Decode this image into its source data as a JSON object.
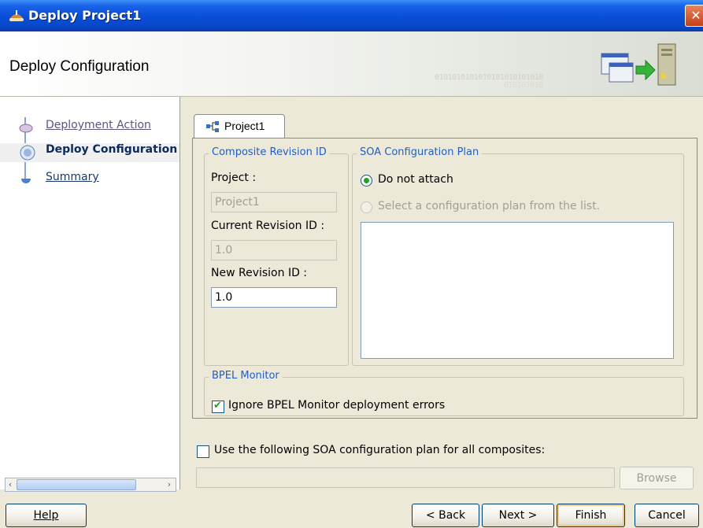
{
  "window": {
    "title": "Deploy Project1",
    "close_glyph": "✕"
  },
  "banner": {
    "heading": "Deploy Configuration",
    "binary_line1": "0101010101010101010101010",
    "binary_line2": "010101010"
  },
  "nav": {
    "items": [
      {
        "label": "Deployment Action",
        "state": "visited"
      },
      {
        "label": "Deploy Configuration",
        "state": "current"
      },
      {
        "label": "Summary",
        "state": "link"
      }
    ]
  },
  "tab": {
    "label": "Project1"
  },
  "revision": {
    "legend": "Composite Revision ID",
    "project_label": "Project :",
    "project_value": "Project1",
    "current_label": "Current Revision ID :",
    "current_value": "1.0",
    "new_label": "New Revision ID :",
    "new_value": "1.0"
  },
  "plan": {
    "legend": "SOA Configuration Plan",
    "option_none": "Do not attach",
    "option_select": "Select a configuration plan from the list."
  },
  "monitor": {
    "legend": "BPEL Monitor",
    "ignore_errors_label": "Ignore BPEL Monitor deployment errors",
    "ignore_errors_checked": true
  },
  "all_composites": {
    "label": "Use the following SOA configuration plan for all composites:",
    "checked": false,
    "path_value": "",
    "browse_label": "Browse"
  },
  "footer": {
    "help": "Help",
    "back": "< Back",
    "next": "Next >",
    "finish": "Finish",
    "cancel": "Cancel"
  },
  "colors": {
    "titlebar": "#0a4fd9",
    "legend_text": "#215dc6",
    "check_mark": "#21a121"
  }
}
